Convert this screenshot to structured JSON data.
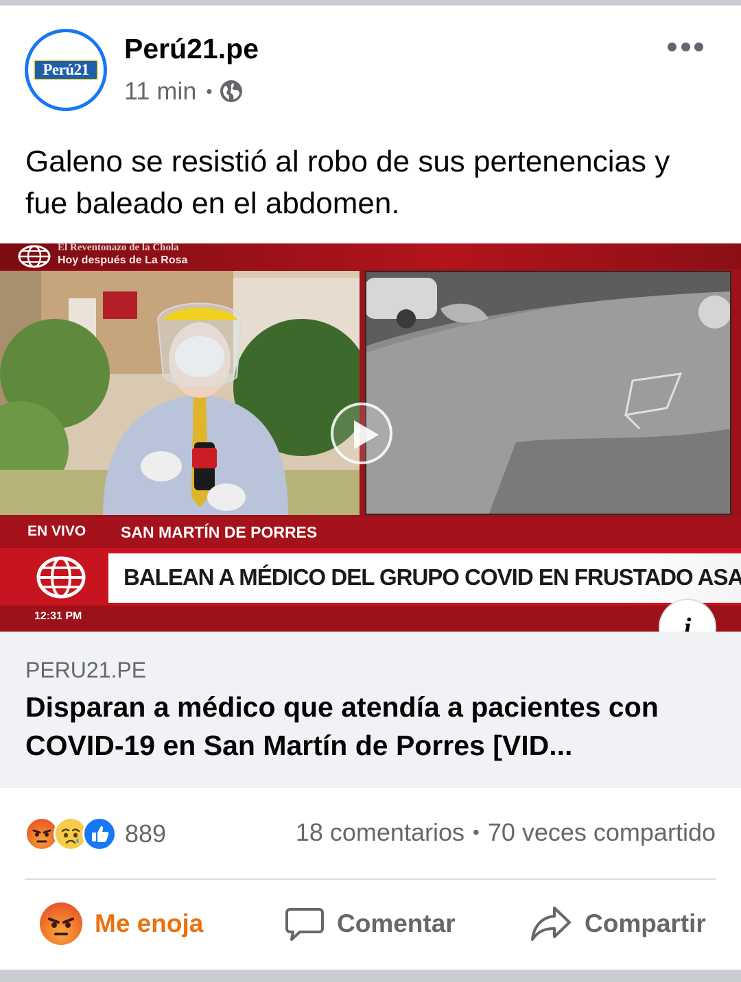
{
  "post": {
    "page_name": "Perú21.pe",
    "avatar_logo": "Perú21",
    "time": "11 min",
    "separator": "•",
    "privacy_icon": "globe-icon",
    "more_icon": "more-horizontal-icon",
    "text": "Galeno se resistió al robo de sus pertenencias y fue baleado en el abdomen."
  },
  "media": {
    "strip_line1": "El Reventonazo de la Chola",
    "strip_line2": "Hoy después de La Rosa",
    "live_label": "EN VIVO",
    "location": "SAN MARTÍN DE PORRES",
    "headline": "BALEAN A MÉDICO DEL GRUPO COVID EN FRUSTADO ASALTO",
    "clock": "12:31 PM",
    "play_icon": "play-icon",
    "info_label": "i"
  },
  "link": {
    "domain": "PERU21.PE",
    "title": "Disparan a médico que atendía a pacientes con COVID-19 en San Martín de Porres [VID..."
  },
  "stats": {
    "reaction_icons": [
      "angry-icon",
      "sad-icon",
      "like-icon"
    ],
    "reaction_count": "889",
    "comments": "18 comentarios",
    "separator": "•",
    "shares": "70 veces compartido"
  },
  "actions": {
    "react_label": "Me enoja",
    "comment_label": "Comentar",
    "share_label": "Compartir"
  },
  "colors": {
    "facebook_blue": "#1877f2",
    "angry_orange": "#e9710f",
    "secondary_text": "#65676b",
    "news_red": "#c8141f"
  }
}
